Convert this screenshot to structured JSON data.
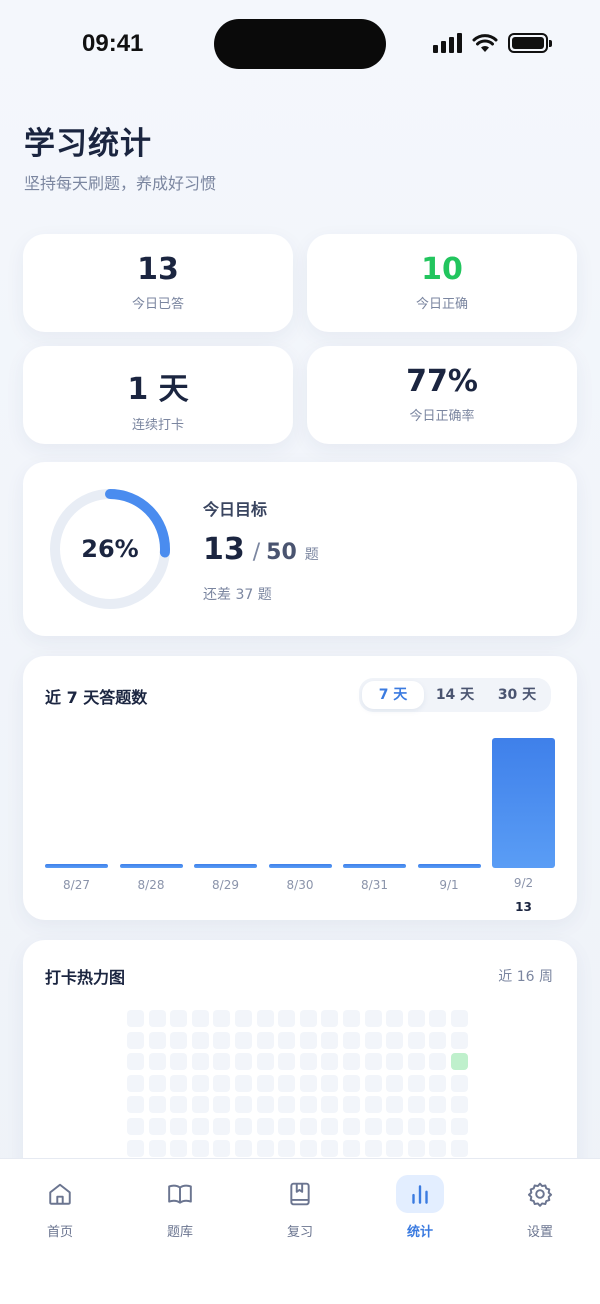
{
  "status_bar": {
    "time": "09:41"
  },
  "header": {
    "title": "学习统计",
    "subtitle": "坚持每天刷题，养成好习惯"
  },
  "stats": [
    {
      "value": "13",
      "label": "今日已答",
      "color": "#1b2540"
    },
    {
      "value": "10",
      "label": "今日正确",
      "color": "#22c55e"
    },
    {
      "value": "1 天",
      "label": "连续打卡",
      "color": "#1b2540"
    },
    {
      "value": "77%",
      "label": "今日正确率",
      "color": "#1b2540"
    }
  ],
  "goal": {
    "percent_text": "26%",
    "progress": 0.26,
    "title": "今日目标",
    "done": "13",
    "separator": "/",
    "total": "50",
    "unit": "题",
    "remaining": "还差 37 题"
  },
  "chart": {
    "title": "近 7 天答题数",
    "ranges": [
      {
        "label": "7 天",
        "active": true
      },
      {
        "label": "14 天",
        "active": false
      },
      {
        "label": "30 天",
        "active": false
      }
    ]
  },
  "chart_data": {
    "type": "bar",
    "categories": [
      "8/27",
      "8/28",
      "8/29",
      "8/30",
      "8/31",
      "9/1",
      "9/2"
    ],
    "values": [
      0,
      0,
      0,
      0,
      0,
      0,
      13
    ],
    "value_labels": [
      "",
      "",
      "",
      "",
      "",
      "",
      "13"
    ],
    "ylim": [
      0,
      13
    ],
    "color": "#4a8cef"
  },
  "heatmap": {
    "title": "打卡热力图",
    "range": "近 16 周",
    "weeks": 16,
    "active_cells": [
      {
        "week": 15,
        "day": 2
      }
    ],
    "active_color": "#bff0cc",
    "empty_color": "#f2f5fa"
  },
  "tab_bar": {
    "items": [
      {
        "label": "首页",
        "icon": "home-icon",
        "active": false
      },
      {
        "label": "题库",
        "icon": "book-icon",
        "active": false
      },
      {
        "label": "复习",
        "icon": "bookmark-book-icon",
        "active": false
      },
      {
        "label": "统计",
        "icon": "bar-chart-icon",
        "active": true
      },
      {
        "label": "设置",
        "icon": "gear-icon",
        "active": false
      }
    ]
  },
  "colors": {
    "accent": "#3b7be0",
    "success": "#22c55e",
    "text": "#1b2540",
    "muted": "#7b86a0"
  }
}
